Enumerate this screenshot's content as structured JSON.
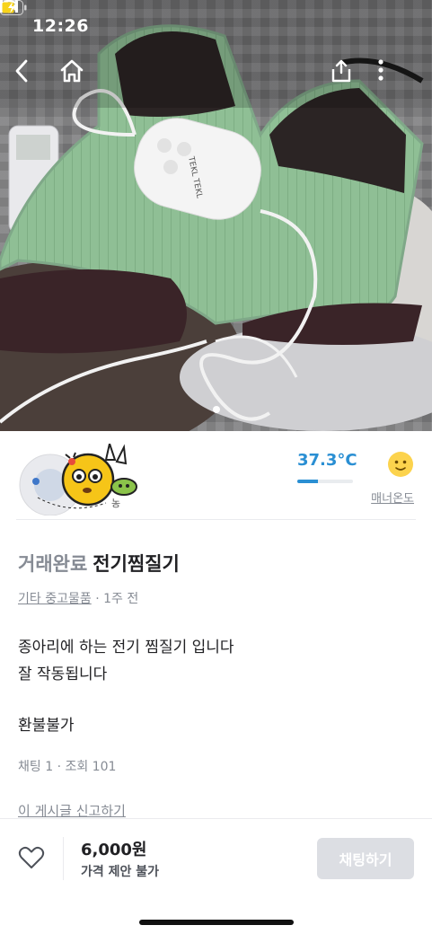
{
  "status_bar": {
    "time": "12:26"
  },
  "photo": {
    "page_count": 1,
    "current_page": 1,
    "device_brand": "TEKL TEKL"
  },
  "seller": {
    "avatar_badge": "농",
    "manner_temperature": "37.3°C",
    "manner_temperature_value": 37.3,
    "manner_label": "매너온도",
    "colors": {
      "temperature": "#2a8fd3"
    }
  },
  "post": {
    "state": "거래완료",
    "title": "전기찜질기",
    "category": "기타 중고물품",
    "time_ago": "· 1주 전",
    "description_lines": [
      "종아리에 하는 전기 찜질기 입니다",
      "잘 작동됩니다"
    ],
    "refund": "환불불가",
    "stats": "채팅 1 · 조회 101",
    "report_label": "이 게시글 신고하기"
  },
  "bottom_bar": {
    "price": "6,000원",
    "offer": "가격 제안 불가",
    "chat_label": "채팅하기"
  },
  "icons": {
    "back": "back-chevron-icon",
    "home": "home-icon",
    "share": "share-icon",
    "more": "more-vertical-icon",
    "heart": "heart-icon"
  }
}
